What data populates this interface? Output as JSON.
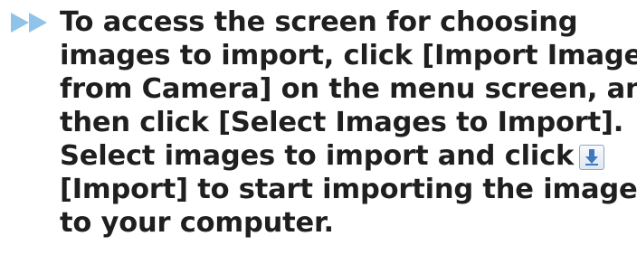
{
  "instruction": {
    "line1": "To access the screen for choosing",
    "line2": "images to import, click [Import Images",
    "line3": "from Camera] on the menu screen, and",
    "line4": "then click [Select Images to Import].",
    "line5": "Select images to import and click",
    "line6": "[Import] to start importing the images",
    "line7": "to your computer."
  },
  "icons": {
    "bullet": "double-chevron-right-icon",
    "import": "import-arrow-icon"
  },
  "colors": {
    "bullet": "#8fc3ea",
    "text": "#1f1f1f",
    "import_icon": "#3f78c0"
  }
}
